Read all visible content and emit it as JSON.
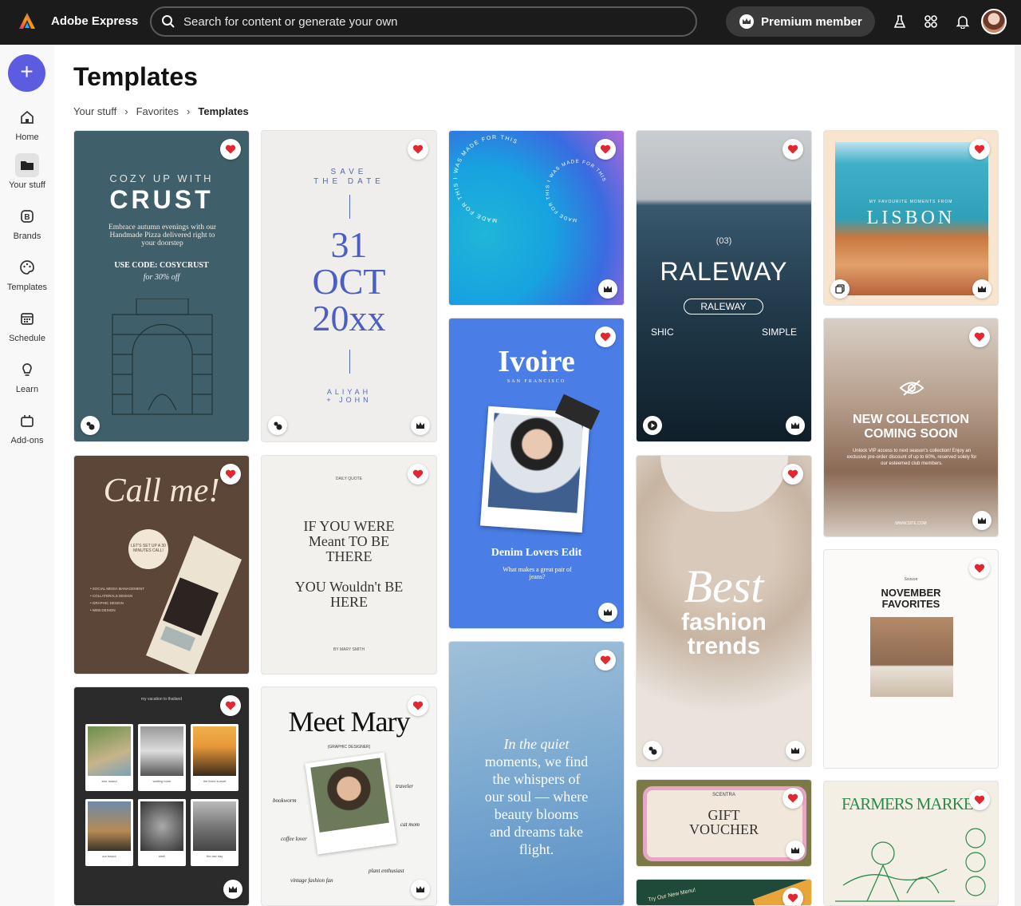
{
  "app": {
    "name": "Adobe Express",
    "search_placeholder": "Search for content or generate your own",
    "premium_label": "Premium member"
  },
  "sidebar": {
    "items": [
      {
        "label": "Home"
      },
      {
        "label": "Your stuff"
      },
      {
        "label": "Brands"
      },
      {
        "label": "Templates"
      },
      {
        "label": "Schedule"
      },
      {
        "label": "Learn"
      },
      {
        "label": "Add-ons"
      }
    ]
  },
  "page": {
    "title": "Templates",
    "breadcrumb": [
      "Your stuff",
      "Favorites",
      "Templates"
    ]
  },
  "cards": {
    "crust": {
      "l1": "COZY UP WITH",
      "l2": "CRUST",
      "l3": "Embrace autumn evenings with our Handmade Pizza delivered right to your doorstep",
      "l4": "USE CODE: COSYCRUST",
      "l5": "for 30% off"
    },
    "save": {
      "l1": "SAVE",
      "l2": "THE DATE",
      "l3": "31",
      "l4": "OCT",
      "l5": "20xx",
      "l6": "ALIYAH",
      "l7": "+ JOHN"
    },
    "gradient": {
      "l1": "MADE FOR THIS I WAS MADE FOR THIS"
    },
    "raleway": {
      "l1": "(03)",
      "l2": "RALEWAY",
      "l3": "RALEWAY",
      "l4": "SHIC",
      "l5": "SIMPLE"
    },
    "lisbon": {
      "l1": "MY FAVOURITE MOMENTS FROM",
      "l2": "LISBON"
    },
    "callme": {
      "l1": "Call me!",
      "l2": "LET'S SET UP A 30 MINUTES CALL!",
      "l3": "• SOCIAL MEDIA MANAGEMENT",
      "l4": "• COLLATERALS DESIGN",
      "l5": "• GRAPHIC DESIGN",
      "l6": "• WEB DESIGN"
    },
    "quote": {
      "l1": "DAILY QUOTE",
      "l2": "IF YOU WERE",
      "l3": "Meant TO BE",
      "l4": "THERE",
      "l5": "YOU Wouldn't BE",
      "l6": "HERE",
      "l7": "BY MARY SMITH"
    },
    "ivoire": {
      "l1": "Ivoire",
      "l2": "SAN FRANCISCO",
      "l3": "Denim Lovers Edit",
      "l4": "What makes a great pair of jeans?"
    },
    "newcoll": {
      "l1": "NEW COLLECTION",
      "l2": "COMING SOON",
      "l3": "Unlock VIP access to next season's collection! Enjoy an exclusive pre-order discount of up to 60%, reserved solely for our esteemed club members.",
      "l4": "WWW.SITE.COM"
    },
    "fashion": {
      "l1": "Best",
      "l2": "fashion",
      "l3": "trends"
    },
    "november": {
      "l1": "Season",
      "l2": "NOVEMBER",
      "l3": "FAVORITES"
    },
    "thailand": {
      "l1": "my vacation to thailand",
      "c1": "sea. island",
      "c2": "waiting room",
      "c3": "the three sunset",
      "c4": "our beach",
      "c5": "shell",
      "c6": "the last day"
    },
    "mary": {
      "l1": "Meet Mary",
      "l2": "(GRAPHIC DESIGNER)",
      "l3": "bookworm",
      "l4": "traveler",
      "l5": "coffee lover",
      "l6": "cat mom",
      "l7": "vintage fashion fan",
      "l8": "plant enthusiast"
    },
    "quiet": {
      "l1": "In the quiet",
      "l2": "moments, we find",
      "l3": "the whispers of",
      "l4": "our soul — where",
      "l5": "beauty blooms",
      "l6": "and dreams take",
      "l7": "flight."
    },
    "voucher": {
      "l1": "SCENTRA",
      "l2": "GIFT",
      "l3": "VOUCHER"
    },
    "farmers": {
      "l1": "FARMERS MARKET"
    },
    "menu": {
      "l1": "Try Our New Menu!"
    }
  },
  "colors": {
    "accent": "#5c5ce0",
    "heart": "#e4262f",
    "topbar": "#1b1b1b"
  }
}
